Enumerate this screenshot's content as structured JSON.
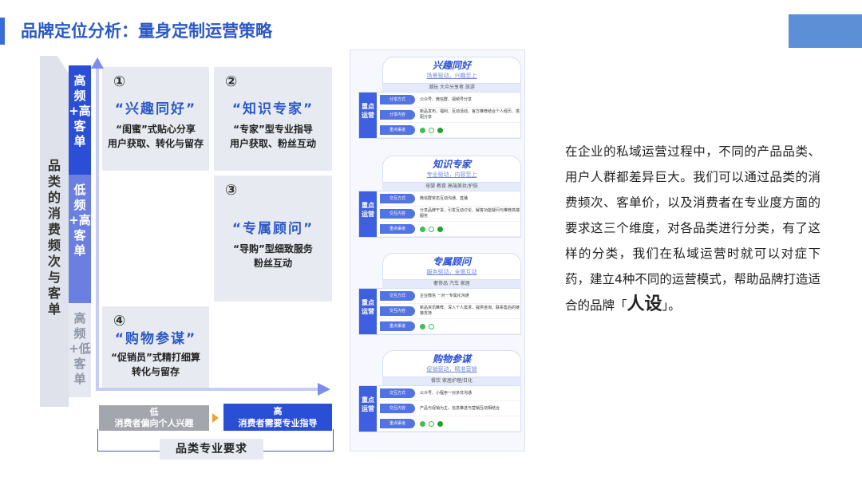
{
  "header": {
    "title": "品牌定位分析：量身定制运营策略"
  },
  "matrix": {
    "y_axis_label": "品类的消费频次与客单",
    "side_labels": [
      "高频+高客单",
      "低频+高客单",
      "高频+低客单"
    ],
    "cells": [
      {
        "num": "①",
        "name": "“兴趣同好”",
        "line1": "“闺蜜”式贴心分享",
        "line2": "用户获取、转化与留存"
      },
      {
        "num": "②",
        "name": "“知识专家”",
        "line1": "“专家”型专业指导",
        "line2": "用户获取、粉丝互动"
      },
      {
        "num": "③",
        "name": "“专属顾问”",
        "line1": "“导购”型细致服务",
        "line2": "粉丝互动"
      },
      {
        "num": "④",
        "name": "“购物参谋”",
        "line1": "“促销员”式精打细算",
        "line2": "转化与留存"
      }
    ],
    "x_low_top": "低",
    "x_low_bottom": "消费者偏向个人兴趣",
    "x_high_top": "高",
    "x_high_bottom": "消费者需要专业指导",
    "x_axis_label": "品类专业要求"
  },
  "cards": [
    {
      "title": "兴趣同好",
      "subtitle": "场景驱动，兴趣至上",
      "band": "潮玩 大众分享者 旅游",
      "side": "重点运营",
      "rows": [
        {
          "label": "分享方式",
          "value": "公众号、微信群、视频号分享"
        },
        {
          "label": "分享内容",
          "value": "新品发布、福利、互动活动、官方推荐结合个人经历、搭配分享"
        },
        {
          "label": "重点渠道",
          "value": ""
        }
      ]
    },
    {
      "title": "知识专家",
      "subtitle": "专业驱动，内容至上",
      "band": "母婴 教育 高端美妆/护肤",
      "side": "重点运营",
      "rows": [
        {
          "label": "交互方式",
          "value": "微信群常态互动沟通、直播"
        },
        {
          "label": "交互内容",
          "value": "分享品牌干货，引发互动讨论、解答功能疑问与推荐高端服务"
        },
        {
          "label": "重点渠道",
          "value": ""
        }
      ]
    },
    {
      "title": "专属顾问",
      "subtitle": "服务驱动，全面互动",
      "band": "奢侈品 汽车 家居",
      "side": "重点运营",
      "rows": [
        {
          "label": "交互方式",
          "value": "企业微信 一对一专属化沟通"
        },
        {
          "label": "交互内容",
          "value": "新品资讯推荐、深入个人需求、提供咨询、联系售后的链接支持"
        },
        {
          "label": "重点渠道",
          "value": ""
        }
      ]
    },
    {
      "title": "购物参谋",
      "subtitle": "促销驱动，精准营销",
      "band": "餐饮 家居护理/日化",
      "side": "重点运营",
      "rows": [
        {
          "label": "交互方式",
          "value": "公众号、小程序一对多非沟通"
        },
        {
          "label": "交互内容",
          "value": "产品与促销为主，信息推送与营销互动相结合"
        },
        {
          "label": "重点渠道",
          "value": ""
        }
      ]
    }
  ],
  "paragraph": {
    "text": "在企业的私域运营过程中，不同的产品品类、用户人群都差异巨大。我们可以通过品类的消费频次、客单价，以及消费者在专业度方面的要求这三个维度，对各品类进行分类，有了这样的分类，我们在私域运营时就可以对症下药，建立4种不同的运营模式，帮助品牌打造适合的品牌「",
    "emphasis": "人设",
    "tail": "」。"
  }
}
